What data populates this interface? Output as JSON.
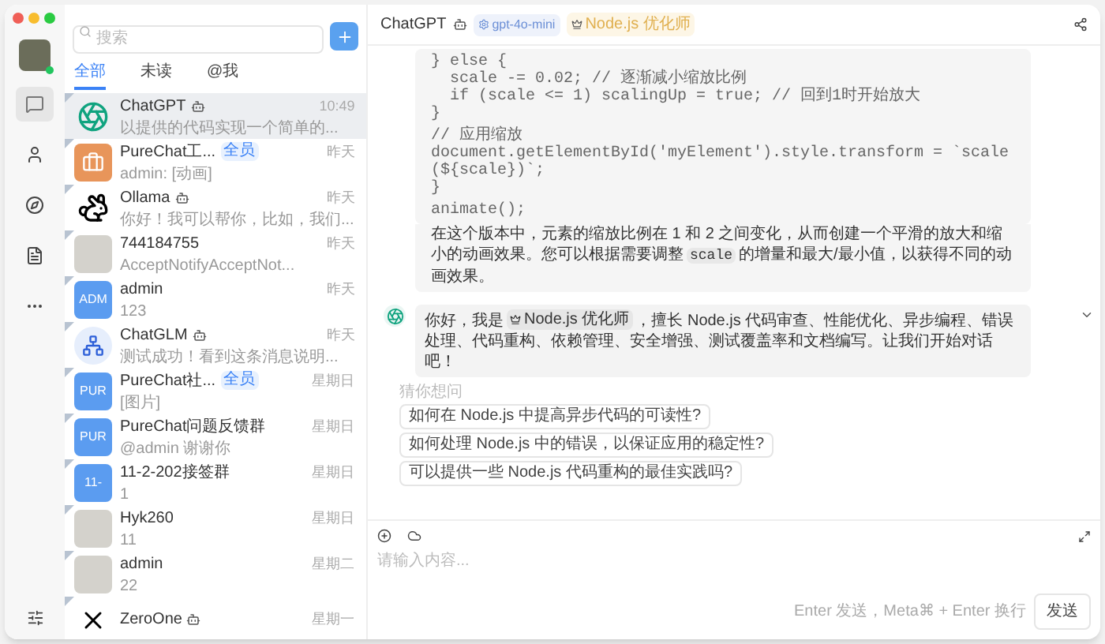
{
  "rail": {
    "online": true,
    "items": [
      {
        "kind": "chat",
        "selected": true
      },
      {
        "kind": "user",
        "selected": false
      },
      {
        "kind": "compass",
        "selected": false
      },
      {
        "kind": "document",
        "selected": false
      },
      {
        "kind": "more",
        "selected": false
      }
    ]
  },
  "search": {
    "placeholder": "搜索"
  },
  "filter_tabs": [
    {
      "label": "全部",
      "selected": true
    },
    {
      "label": "未读",
      "selected": false
    },
    {
      "label": "@我",
      "selected": false
    }
  ],
  "conversations": [
    {
      "name": "ChatGPT",
      "bot": true,
      "time": "10:49",
      "preview": "以提供的代码实现一个简单的...",
      "avatar": {
        "kind": "logo"
      },
      "selected": true,
      "pinned": true
    },
    {
      "name": "PureChat工...",
      "badge": "全员",
      "bot": false,
      "time": "昨天",
      "preview": "admin: [动画]",
      "avatar": {
        "kind": "briefcase"
      },
      "selected": false,
      "pinned": true
    },
    {
      "name": "Ollama",
      "bot": true,
      "time": "昨天",
      "preview": "你好！我可以帮你，比如，我们...",
      "avatar": {
        "kind": "animal"
      },
      "selected": false,
      "pinned": true
    },
    {
      "name": "744184755",
      "bot": false,
      "time": "昨天",
      "preview": "AcceptNotifyAcceptNot...",
      "avatar": {
        "kind": "photo"
      },
      "selected": false,
      "pinned": true
    },
    {
      "name": "admin",
      "bot": false,
      "time": "昨天",
      "preview": "123",
      "avatar": {
        "kind": "text",
        "text": "ADM"
      },
      "selected": false,
      "pinned": true
    },
    {
      "name": "ChatGLM",
      "bot": true,
      "time": "昨天",
      "preview": "测试成功！看到这条消息说明...",
      "avatar": {
        "kind": "network"
      },
      "selected": false,
      "pinned": true
    },
    {
      "name": "PureChat社...",
      "badge": "全员",
      "bot": false,
      "time": "星期日",
      "preview": "[图片]",
      "avatar": {
        "kind": "text",
        "text": "PUR"
      },
      "selected": false,
      "pinned": true
    },
    {
      "name": "PureChat问题反馈群",
      "bot": false,
      "time": "星期日",
      "preview": "@admin 谢谢你",
      "avatar": {
        "kind": "text",
        "text": "PUR"
      },
      "selected": false,
      "pinned": true
    },
    {
      "name": "11-2-202接签群",
      "bot": false,
      "time": "星期日",
      "preview": "1",
      "avatar": {
        "kind": "text",
        "text": "11-"
      },
      "selected": false,
      "pinned": true
    },
    {
      "name": "Hyk260",
      "bot": false,
      "time": "星期日",
      "preview": "11",
      "avatar": {
        "kind": "photo"
      },
      "selected": false,
      "pinned": true
    },
    {
      "name": "admin",
      "bot": false,
      "time": "星期二",
      "preview": "22",
      "avatar": {
        "kind": "photo"
      },
      "selected": false,
      "pinned": true
    },
    {
      "name": "ZeroOne",
      "bot": true,
      "time": "星期一",
      "avatar": {
        "kind": "cross"
      },
      "selected": false,
      "pinned": true
    }
  ],
  "chat": {
    "title": "ChatGPT",
    "bot": true,
    "model_tag": "gpt-4o-mini",
    "role_tag": "Node.js 优化师"
  },
  "code": [
    [
      "} else {",
      "  scale -= 0.02; // 逐渐减小缩放比例",
      "  if (scale <= 1) scalingUp = true; // 回到1时开始放大",
      "}"
    ],
    [
      "// 应用缩放",
      "document.getElementById('myElement').style.transform = `scale(${scale})`;",
      "}"
    ],
    [
      "animate();"
    ]
  ],
  "reply": {
    "before": "在这个版本中，元素的缩放比例在 1 和 2 之间变化，从而创建一个平滑的放大和缩小的动画效果。您可以根据需要调整",
    "code": "scale",
    "after": "的增量和最大/最小值，以获得不同的动画效果。"
  },
  "greeting": {
    "before": "你好，我是",
    "tag": "Node.js 优化师",
    "after": "，擅长 Node.js 代码审查、性能优化、异步编程、错误处理、代码重构、依赖管理、安全增强、测试覆盖率和文档编写。让我们开始对话吧！"
  },
  "suggestions_label": "猜你想问",
  "suggestions": [
    "如何在 Node.js 中提高异步代码的可读性?",
    "如何处理 Node.js 中的错误，以保证应用的稳定性?",
    "可以提供一些 Node.js 代码重构的最佳实践吗?"
  ],
  "composer": {
    "placeholder": "请输入内容...",
    "hint": "Enter 发送，Meta⌘ + Enter 换行",
    "send": "发送"
  }
}
